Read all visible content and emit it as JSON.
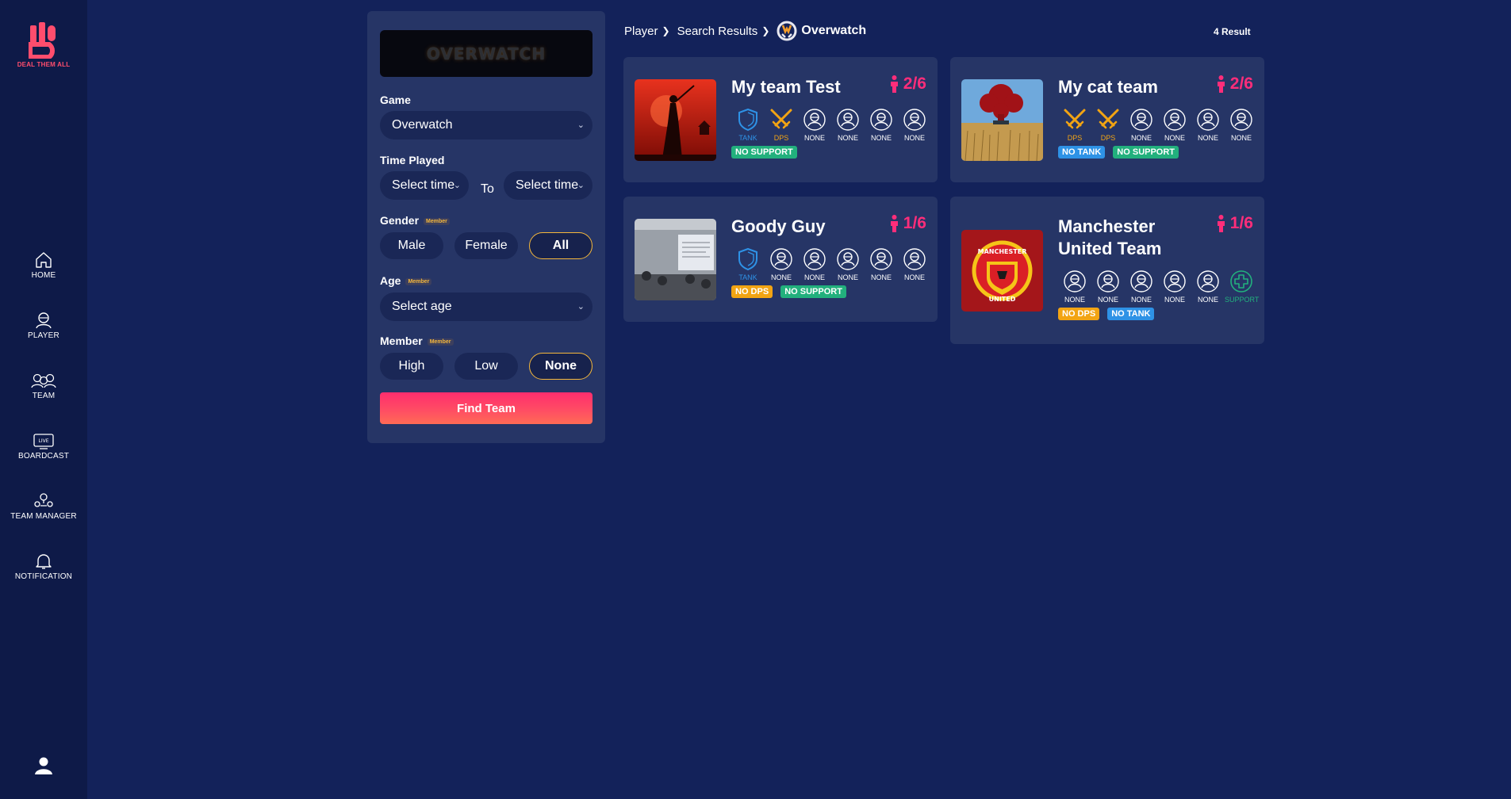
{
  "app": {
    "brand": "DEAL THEM ALL",
    "colors": {
      "background": "#13225a",
      "sidebar": "#0e1a48",
      "card": "#263566",
      "accent": "#ff2d7a",
      "tank": "#2e92e6",
      "dps": "#f2a413",
      "support": "#22b07d",
      "highlight": "#f5b73b"
    }
  },
  "sidebar": {
    "items": [
      {
        "label": "HOME",
        "icon": "home-icon"
      },
      {
        "label": "PLAYER",
        "icon": "player-icon"
      },
      {
        "label": "TEAM",
        "icon": "team-icon"
      },
      {
        "label": "BOARDCAST",
        "icon": "live-icon"
      },
      {
        "label": "TEAM MANAGER",
        "icon": "team-manager-icon"
      },
      {
        "label": "NOTIFICATION",
        "icon": "bell-icon"
      }
    ],
    "profile_icon": "user-icon"
  },
  "filter": {
    "banner_text": "OVERWATCH",
    "game_label": "Game",
    "game_value": "Overwatch",
    "time_label": "Time Played",
    "time_from": "Select time",
    "time_to_word": "To",
    "time_to": "Select time",
    "gender_label": "Gender",
    "member_badge": "Member",
    "gender_options": [
      "Male",
      "Female",
      "All"
    ],
    "gender_selected": "All",
    "age_label": "Age",
    "age_value": "Select age",
    "member_label": "Member",
    "member_options": [
      "High",
      "Low",
      "None"
    ],
    "member_selected": "None",
    "find_button": "Find Team"
  },
  "breadcrumb": {
    "items": [
      "Player",
      "Search Results"
    ],
    "game": "Overwatch",
    "result_count": "4 Result"
  },
  "teams": [
    {
      "name": "My team Test",
      "count": "2/6",
      "image": "samurai-sunset",
      "slots": [
        {
          "role": "tank",
          "label": "TANK"
        },
        {
          "role": "dps",
          "label": "DPS"
        },
        {
          "role": "none",
          "label": "NONE"
        },
        {
          "role": "none",
          "label": "NONE"
        },
        {
          "role": "none",
          "label": "NONE"
        },
        {
          "role": "none",
          "label": "NONE"
        }
      ],
      "tags": [
        {
          "type": "support",
          "label": "NO SUPPORT"
        }
      ]
    },
    {
      "name": "My cat team",
      "count": "2/6",
      "image": "wheat-field-smoke",
      "slots": [
        {
          "role": "dps",
          "label": "DPS"
        },
        {
          "role": "dps",
          "label": "DPS"
        },
        {
          "role": "none",
          "label": "NONE"
        },
        {
          "role": "none",
          "label": "NONE"
        },
        {
          "role": "none",
          "label": "NONE"
        },
        {
          "role": "none",
          "label": "NONE"
        }
      ],
      "tags": [
        {
          "type": "tank",
          "label": "NO TANK"
        },
        {
          "type": "support",
          "label": "NO SUPPORT"
        }
      ]
    },
    {
      "name": "Goody Guy",
      "count": "1/6",
      "image": "classroom",
      "slots": [
        {
          "role": "tank",
          "label": "TANK"
        },
        {
          "role": "none",
          "label": "NONE"
        },
        {
          "role": "none",
          "label": "NONE"
        },
        {
          "role": "none",
          "label": "NONE"
        },
        {
          "role": "none",
          "label": "NONE"
        },
        {
          "role": "none",
          "label": "NONE"
        }
      ],
      "tags": [
        {
          "type": "dps",
          "label": "NO DPS"
        },
        {
          "type": "support",
          "label": "NO SUPPORT"
        }
      ]
    },
    {
      "name_line1": "Manchester",
      "name_line2": "United Team",
      "count": "1/6",
      "image": "manchester-united-crest",
      "slots": [
        {
          "role": "none",
          "label": "NONE"
        },
        {
          "role": "none",
          "label": "NONE"
        },
        {
          "role": "none",
          "label": "NONE"
        },
        {
          "role": "none",
          "label": "NONE"
        },
        {
          "role": "none",
          "label": "NONE"
        },
        {
          "role": "support",
          "label": "SUPPORT"
        }
      ],
      "tags": [
        {
          "type": "dps",
          "label": "NO DPS"
        },
        {
          "type": "tank",
          "label": "NO TANK"
        }
      ]
    }
  ]
}
